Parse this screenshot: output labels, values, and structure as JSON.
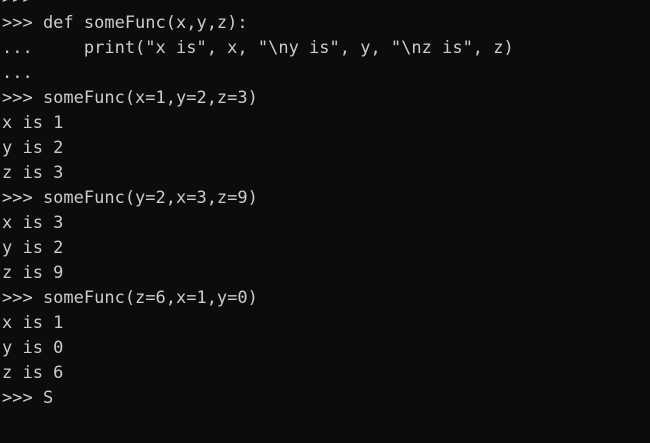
{
  "terminal": {
    "lines": [
      ">>>",
      ">>> def someFunc(x,y,z):",
      "...     print(\"x is\", x, \"\\ny is\", y, \"\\nz is\", z)",
      "...",
      ">>> someFunc(x=1,y=2,z=3)",
      "x is 1",
      "y is 2",
      "z is 3",
      ">>> someFunc(y=2,x=3,z=9)",
      "x is 3",
      "y is 2",
      "z is 9",
      ">>> someFunc(z=6,x=1,y=0)",
      "x is 1",
      "y is 0",
      "z is 6",
      ">>> S"
    ],
    "colors": {
      "background": "#0c0c0c",
      "foreground": "#cccccc"
    }
  }
}
